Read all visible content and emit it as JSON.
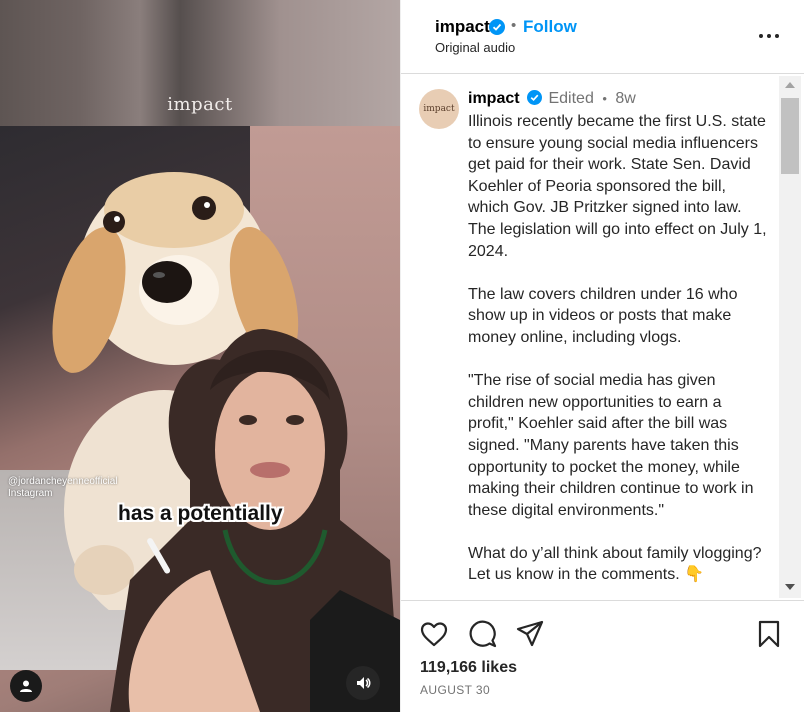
{
  "video": {
    "watermark": "impact",
    "handle_line1": "@jordancheyenneofficial",
    "handle_line2": "Instagram",
    "caption": "has a potentially"
  },
  "header": {
    "account_name": "impact",
    "dot": "•",
    "follow_label": "Follow",
    "audio_label": "Original audio"
  },
  "post": {
    "avatar_text": "impact",
    "author": "impact",
    "edited": "Edited",
    "dot": "•",
    "age": "8w",
    "paragraphs": [
      "Illinois recently became the first U.S. state to ensure young social media influencers get paid for their work. State Sen. David Koehler of Peoria sponsored the bill, which Gov. JB Pritzker signed into law. The legislation will go into effect on July 1, 2024.",
      "The law covers children under 16 who show up in videos or posts that make money online, including vlogs.",
      "\"The rise of social media has given children new opportunities to earn a profit,\" Koehler said after the bill was signed. \"Many parents have taken this opportunity to pocket the money, while making their children continue to work in these digital environments.\"",
      "What do y’all think about family vlogging? Let us know in the comments. 👇"
    ]
  },
  "footer": {
    "likes": "119,166 likes",
    "date": "AUGUST 30"
  },
  "colors": {
    "link_blue": "#0095f6",
    "verified_blue": "#0095f6",
    "muted_text": "#737373"
  }
}
